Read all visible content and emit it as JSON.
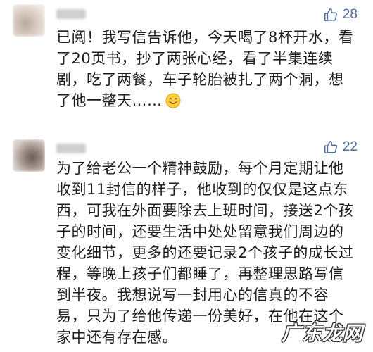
{
  "comments": [
    {
      "likes": "28",
      "text": "已阅！我写信告诉他，今天喝了8杯开水，看了20页书，抄了两张心经，看了半集连续剧，吃了两餐，车子轮胎被扎了两个洞，想了他一整天……",
      "emoji": "smiling-face-emoji"
    },
    {
      "likes": "22",
      "text": "为了给老公一个精神鼓励，每个月定期让他收到11封信的样子，他收到的仅仅是这点东西，可我在外面要除去上班时间，接送2个孩子的时间，还要生活中处处留意我们周边的变化细节，更多的还要记录2个孩子的成长过程，等晚上孩子们都睡了，再整理思路写信到半夜。我想说写一封用心的信真的不容易，只为了给他传递一份美好，在他在这个家中还有存在感。"
    }
  ],
  "watermark": "广东龙网",
  "colors": {
    "like_blue": "#4d6b9c",
    "text": "#1e1e1e"
  },
  "icons": {
    "like": "thumbs-up-icon"
  }
}
